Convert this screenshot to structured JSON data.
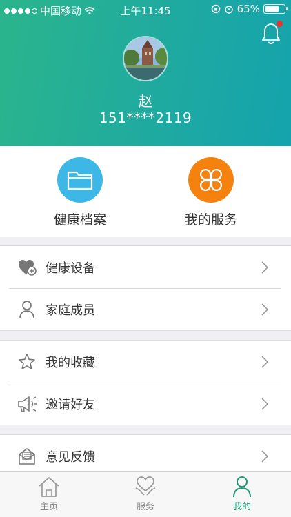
{
  "status_bar": {
    "carrier": "中国移动",
    "time": "上午11:45",
    "battery": "65%",
    "battery_level": 0.65
  },
  "profile": {
    "name": "赵",
    "phone": "151****2119",
    "notification_badge": true
  },
  "quick_actions": [
    {
      "label": "健康档案",
      "icon": "folder-icon",
      "color": "#3db8e6"
    },
    {
      "label": "我的服务",
      "icon": "clover-icon",
      "color": "#f5820f"
    }
  ],
  "menu_groups": [
    {
      "items": [
        {
          "label": "健康设备",
          "icon": "heart-device-icon"
        },
        {
          "label": "家庭成员",
          "icon": "person-icon"
        }
      ]
    },
    {
      "items": [
        {
          "label": "我的收藏",
          "icon": "star-icon"
        },
        {
          "label": "邀请好友",
          "icon": "megaphone-icon"
        }
      ]
    },
    {
      "items": [
        {
          "label": "意见反馈",
          "icon": "feedback-mail-icon"
        }
      ]
    }
  ],
  "tabbar": {
    "tabs": [
      {
        "label": "主页",
        "icon": "home-icon",
        "active": false
      },
      {
        "label": "服务",
        "icon": "heart-hands-icon",
        "active": false
      },
      {
        "label": "我的",
        "icon": "person-icon",
        "active": true
      }
    ]
  },
  "colors": {
    "header_start": "#2bb58c",
    "header_end": "#15a3ad",
    "active_tab": "#1f9a77",
    "badge": "#e8322c"
  }
}
